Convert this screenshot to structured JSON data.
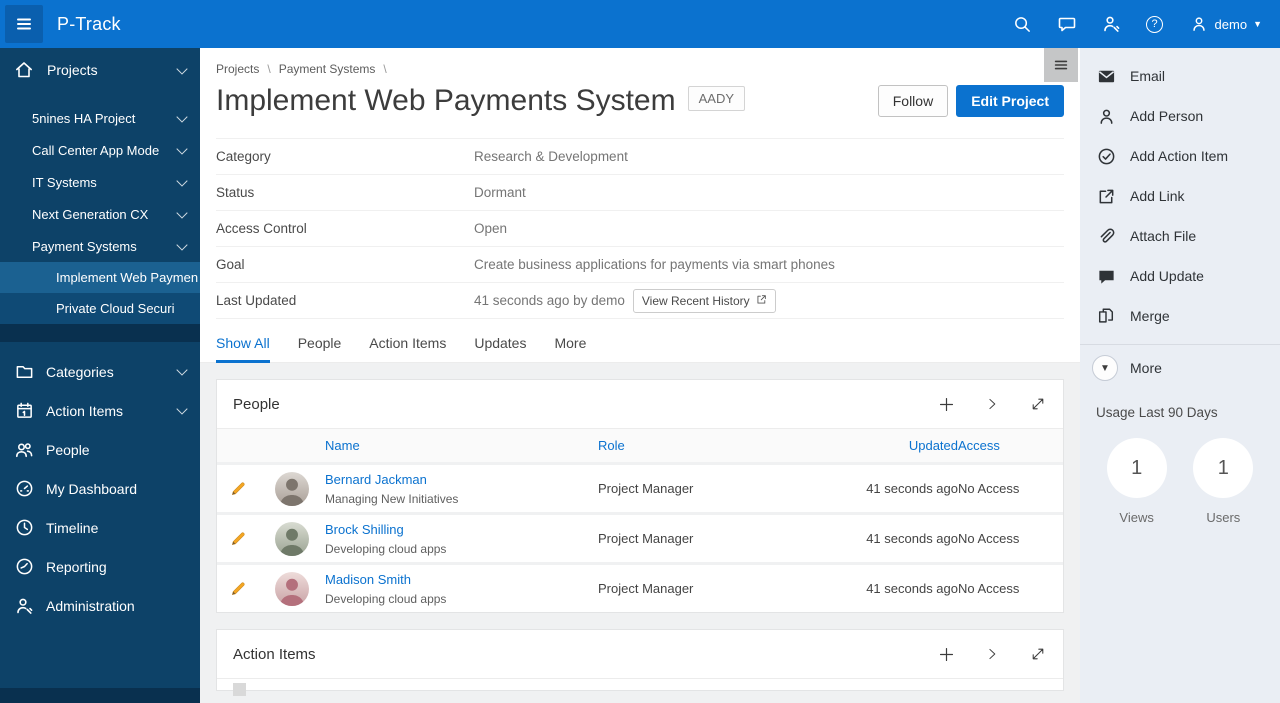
{
  "colors": {
    "accent_blue": "#0b72cf",
    "topbar_bg": "#0b72cf",
    "sidebar_bg": "#0d4268",
    "sidebar_subgroup_bg": "#0f4a75",
    "sidebar_selected_bg": "#1b6191",
    "right_panel_bg": "#eaeef4",
    "page_bg": "#f0f1f2",
    "link_blue": "#0b72cf",
    "edit_pencil_orange": "#f5a623"
  },
  "topbar": {
    "app_title": "P-Track",
    "user_label": "demo",
    "icons": [
      "menu-icon",
      "search-icon",
      "chat-icon",
      "user-wrench-icon",
      "help-icon",
      "user-icon",
      "caret-down-icon"
    ]
  },
  "sidebar": {
    "projects_label": "Projects",
    "project_items": [
      {
        "label": "5nines HA Project"
      },
      {
        "label": "Call Center App Mode"
      },
      {
        "label": "IT Systems"
      },
      {
        "label": "Next Generation CX"
      },
      {
        "label": "Payment Systems"
      }
    ],
    "payment_children": [
      {
        "label": "Implement Web Paymen",
        "selected": true
      },
      {
        "label": "Private Cloud Securi",
        "selected": false
      }
    ],
    "bottom_items": [
      {
        "label": "Categories",
        "icon": "folder-icon"
      },
      {
        "label": "Action Items",
        "icon": "calendar-icon"
      },
      {
        "label": "People",
        "icon": "people-icon"
      },
      {
        "label": "My Dashboard",
        "icon": "dashboard-gauge-icon"
      },
      {
        "label": "Timeline",
        "icon": "clock-icon"
      },
      {
        "label": "Reporting",
        "icon": "reporting-gauge-icon"
      },
      {
        "label": "Administration",
        "icon": "user-wrench-icon"
      }
    ]
  },
  "breadcrumb": {
    "items": [
      "Projects",
      "Payment Systems"
    ],
    "separator": "\\"
  },
  "header": {
    "title": "Implement Web Payments System",
    "badge": "AADY",
    "follow_button": "Follow",
    "edit_button": "Edit Project"
  },
  "details": {
    "rows": [
      {
        "label": "Category",
        "value": "Research & Development"
      },
      {
        "label": "Status",
        "value": "Dormant"
      },
      {
        "label": "Access Control",
        "value": "Open"
      },
      {
        "label": "Goal",
        "value": "Create business applications for payments via smart phones"
      },
      {
        "label": "Last Updated",
        "value": "41 seconds ago by demo",
        "action": "View Recent History"
      }
    ]
  },
  "tabs": {
    "items": [
      {
        "label": "Show All",
        "active": true
      },
      {
        "label": "People",
        "active": false
      },
      {
        "label": "Action Items",
        "active": false
      },
      {
        "label": "Updates",
        "active": false
      },
      {
        "label": "More",
        "active": false
      }
    ]
  },
  "people": {
    "title": "People",
    "columns": [
      "Name",
      "Role",
      "Updated",
      "Access"
    ],
    "rows": [
      {
        "name": "Bernard Jackman",
        "subtitle": "Managing New Initiatives",
        "role": "Project Manager",
        "updated": "41 seconds ago",
        "access": "No Access"
      },
      {
        "name": "Brock Shilling",
        "subtitle": "Developing cloud apps",
        "role": "Project Manager",
        "updated": "41 seconds ago",
        "access": "No Access"
      },
      {
        "name": "Madison Smith",
        "subtitle": "Developing cloud apps",
        "role": "Project Manager",
        "updated": "41 seconds ago",
        "access": "No Access"
      }
    ]
  },
  "action_items": {
    "title": "Action Items"
  },
  "right_panel": {
    "actions": [
      {
        "label": "Email",
        "icon": "email-icon"
      },
      {
        "label": "Add Person",
        "icon": "add-person-icon"
      },
      {
        "label": "Add Action Item",
        "icon": "check-circle-icon"
      },
      {
        "label": "Add Link",
        "icon": "external-link-icon"
      },
      {
        "label": "Attach File",
        "icon": "paperclip-icon"
      },
      {
        "label": "Add Update",
        "icon": "speech-bubble-icon"
      },
      {
        "label": "Merge",
        "icon": "merge-icon"
      }
    ],
    "more_label": "More",
    "usage": {
      "title": "Usage Last 90 Days",
      "stats": [
        {
          "value": "1",
          "label": "Views"
        },
        {
          "value": "1",
          "label": "Users"
        }
      ]
    }
  }
}
